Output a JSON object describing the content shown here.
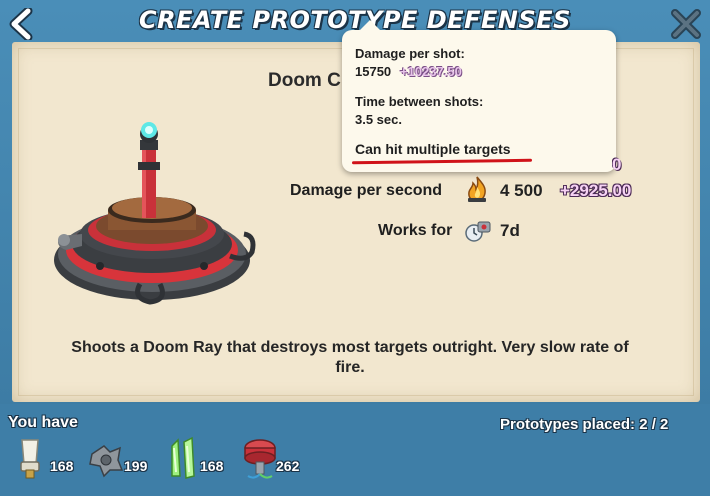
{
  "header": {
    "title": "CREATE PROTOTYPE DEFENSES"
  },
  "item": {
    "name": "Doom C",
    "description": "Shoots a Doom Ray that destroys most targets outright. Very slow rate of fire."
  },
  "stats": {
    "dps_label": "Damage per second",
    "dps_value": "4 500",
    "dps_bonus": "+2925.00",
    "duration_label": "Works for",
    "duration_value": "7d",
    "hidden_bonus_fragment": "0"
  },
  "tooltip": {
    "damage_label": "Damage per shot:",
    "damage_value": "15750",
    "damage_bonus": "+10237.50",
    "interval_label": "Time between shots:",
    "interval_value": "3.5 sec.",
    "multi_target": "Can hit multiple targets"
  },
  "footer": {
    "you_have_label": "You have",
    "prototypes_placed": "Prototypes placed: 2 / 2",
    "resources": [
      {
        "icon": "stone-fuse-icon",
        "count": "168"
      },
      {
        "icon": "iron-gear-icon",
        "count": "199"
      },
      {
        "icon": "green-crystal-icon",
        "count": "168"
      },
      {
        "icon": "red-dial-icon",
        "count": "262"
      }
    ]
  },
  "colors": {
    "frame": "#3f7fa6",
    "parchment": "#f2e7cf",
    "bonus": "#f6d2f4",
    "underline": "#d0131a"
  }
}
